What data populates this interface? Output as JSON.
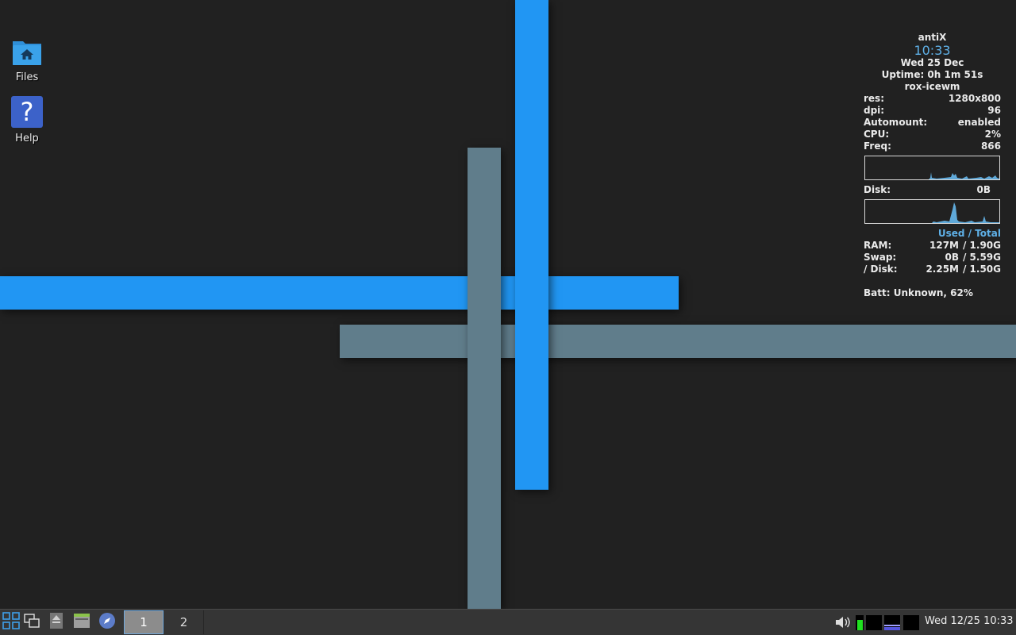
{
  "desktop": {
    "icons": [
      {
        "label": "Files",
        "icon": "home-folder-icon"
      },
      {
        "label": "Help",
        "icon": "help-question-icon"
      }
    ],
    "wallpaper_colors": {
      "background": "#212121",
      "blue": "#2196f3",
      "gray": "#607d8b"
    }
  },
  "conky": {
    "hostname": "antiX",
    "time": "10:33",
    "date": "Wed 25 Dec",
    "uptime": "Uptime: 0h 1m 51s",
    "session": "rox-icewm",
    "stats": [
      {
        "key": "res:",
        "value": "1280x800"
      },
      {
        "key": "dpi:",
        "value": "96"
      },
      {
        "key": "Automount:",
        "value": "enabled"
      },
      {
        "key": "CPU:",
        "value": "2%"
      },
      {
        "key": "Freq:",
        "value": "866"
      }
    ],
    "disk": {
      "key": "Disk:",
      "value": "0B"
    },
    "mem_header": "Used / Total",
    "mem": [
      {
        "key": "RAM:",
        "used": "127M",
        "total": "/ 1.90G"
      },
      {
        "key": "Swap:",
        "used": "0B",
        "total": "/ 5.59G"
      },
      {
        "key": "/ Disk:",
        "used": "2.25M",
        "total": "/ 1.50G"
      }
    ],
    "battery": "Batt: Unknown, 62%",
    "accent_color": "#5fb1e8"
  },
  "taskbar": {
    "start_icon": "start-menu-icon",
    "buttons": [
      {
        "icon": "window-list-icon"
      },
      {
        "icon": "show-desktop-icon"
      },
      {
        "icon": "file-manager-icon"
      },
      {
        "icon": "web-browser-icon"
      }
    ],
    "workspaces": [
      {
        "label": "1",
        "active": true
      },
      {
        "label": "2",
        "active": false
      }
    ],
    "tray": {
      "volume_icon": "volume-icon",
      "clock": "Wed 12/25 10:33"
    }
  }
}
